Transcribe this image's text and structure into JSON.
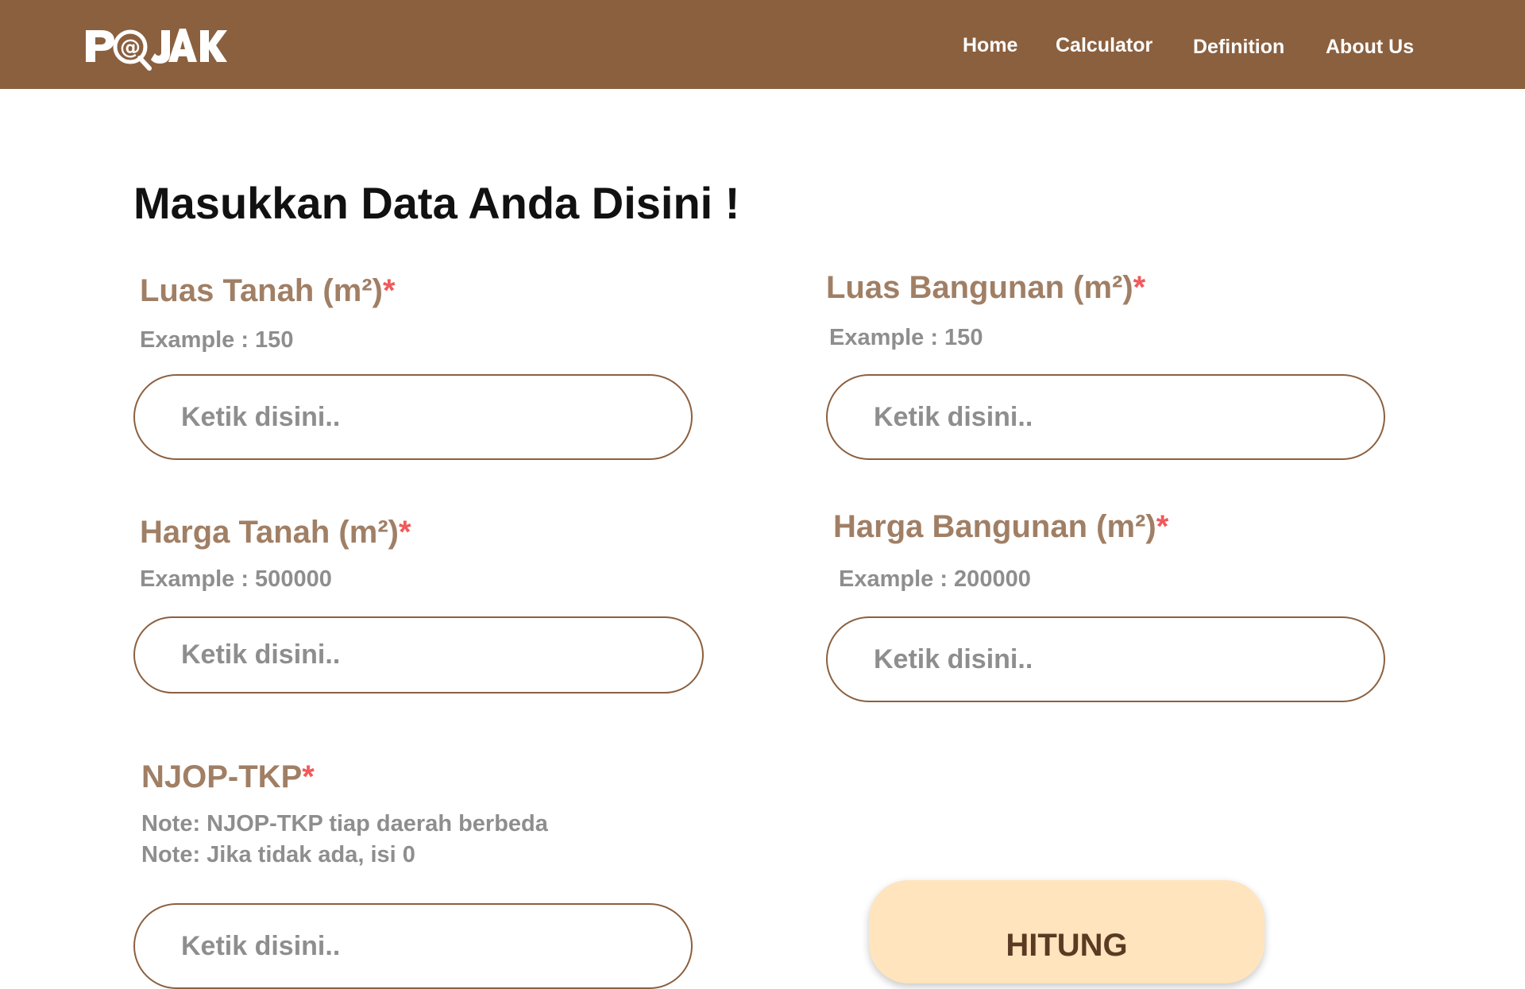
{
  "header": {
    "logo_text": "P@JAK",
    "nav": [
      {
        "label": "Home"
      },
      {
        "label": "Calculator"
      },
      {
        "label": "Definition"
      },
      {
        "label": "About Us"
      }
    ]
  },
  "form": {
    "title": "Masukkan Data Anda Disini !",
    "required_marker": "*",
    "fields": [
      {
        "label": "Luas Tanah (m²)",
        "hint": "Example : 150",
        "placeholder": "Ketik disini..",
        "value": ""
      },
      {
        "label": "Luas Bangunan (m²)",
        "hint": "Example : 150",
        "placeholder": "Ketik disini..",
        "value": ""
      },
      {
        "label": "Harga Tanah (m²)",
        "hint": "Example : 500000",
        "placeholder": "Ketik disini..",
        "value": ""
      },
      {
        "label": "Harga Bangunan (m²)",
        "hint": "Example : 200000",
        "placeholder": "Ketik disini..",
        "value": ""
      },
      {
        "label": "NJOP-TKP",
        "hints": [
          "Note: NJOP-TKP tiap daerah berbeda",
          "Note: Jika tidak ada, isi 0"
        ],
        "placeholder": "Ketik disini..",
        "value": ""
      }
    ],
    "submit_label": "HITUNG"
  },
  "colors": {
    "header_bg": "#8b603f",
    "label": "#a07f65",
    "required": "#f05a5a",
    "hint": "#8e8e8e",
    "input_border": "#8b603f",
    "button_bg": "#ffe4bd",
    "button_text": "#5a3a22"
  },
  "icons": {
    "logo": "magnifier-at-logo-icon"
  }
}
